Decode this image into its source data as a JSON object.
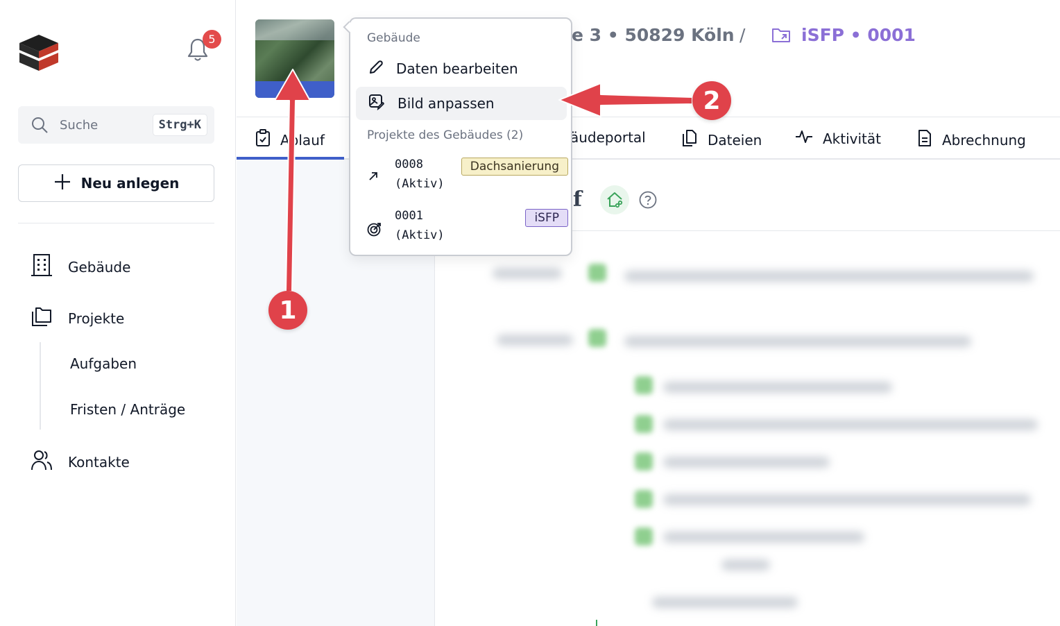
{
  "sidebar": {
    "notification_count": "5",
    "search": {
      "placeholder": "Suche",
      "shortcut": "Strg+K"
    },
    "new_button": "Neu anlegen",
    "nav": {
      "buildings": "Gebäude",
      "projects": "Projekte",
      "tasks": "Aufgaben",
      "deadlines": "Fristen / Anträge",
      "contacts": "Kontakte"
    }
  },
  "header": {
    "address_fragment": "e 3 • 50829 Köln",
    "separator": "/",
    "project_title": "iSFP • 0001"
  },
  "tabs": {
    "ablauf": "Ablauf",
    "portal": "äudeportal",
    "files": "Dateien",
    "activity": "Aktivität",
    "billing": "Abrechnung"
  },
  "toolbar": {
    "f_label": "f"
  },
  "popover": {
    "section_building": "Gebäude",
    "edit_data": "Daten bearbeiten",
    "adjust_image": "Bild anpassen",
    "section_projects": "Projekte des Gebäudes (2)",
    "projects": [
      {
        "number": "0008",
        "status": "(Aktiv)",
        "tag": "Dachsanierung"
      },
      {
        "number": "0001",
        "status": "(Aktiv)",
        "tag": "iSFP"
      }
    ]
  },
  "annotations": {
    "step1": "1",
    "step2": "2"
  },
  "colors": {
    "accent": "#3f5fc9",
    "project": "#8b6fd6",
    "arrow": "#e0424a"
  }
}
